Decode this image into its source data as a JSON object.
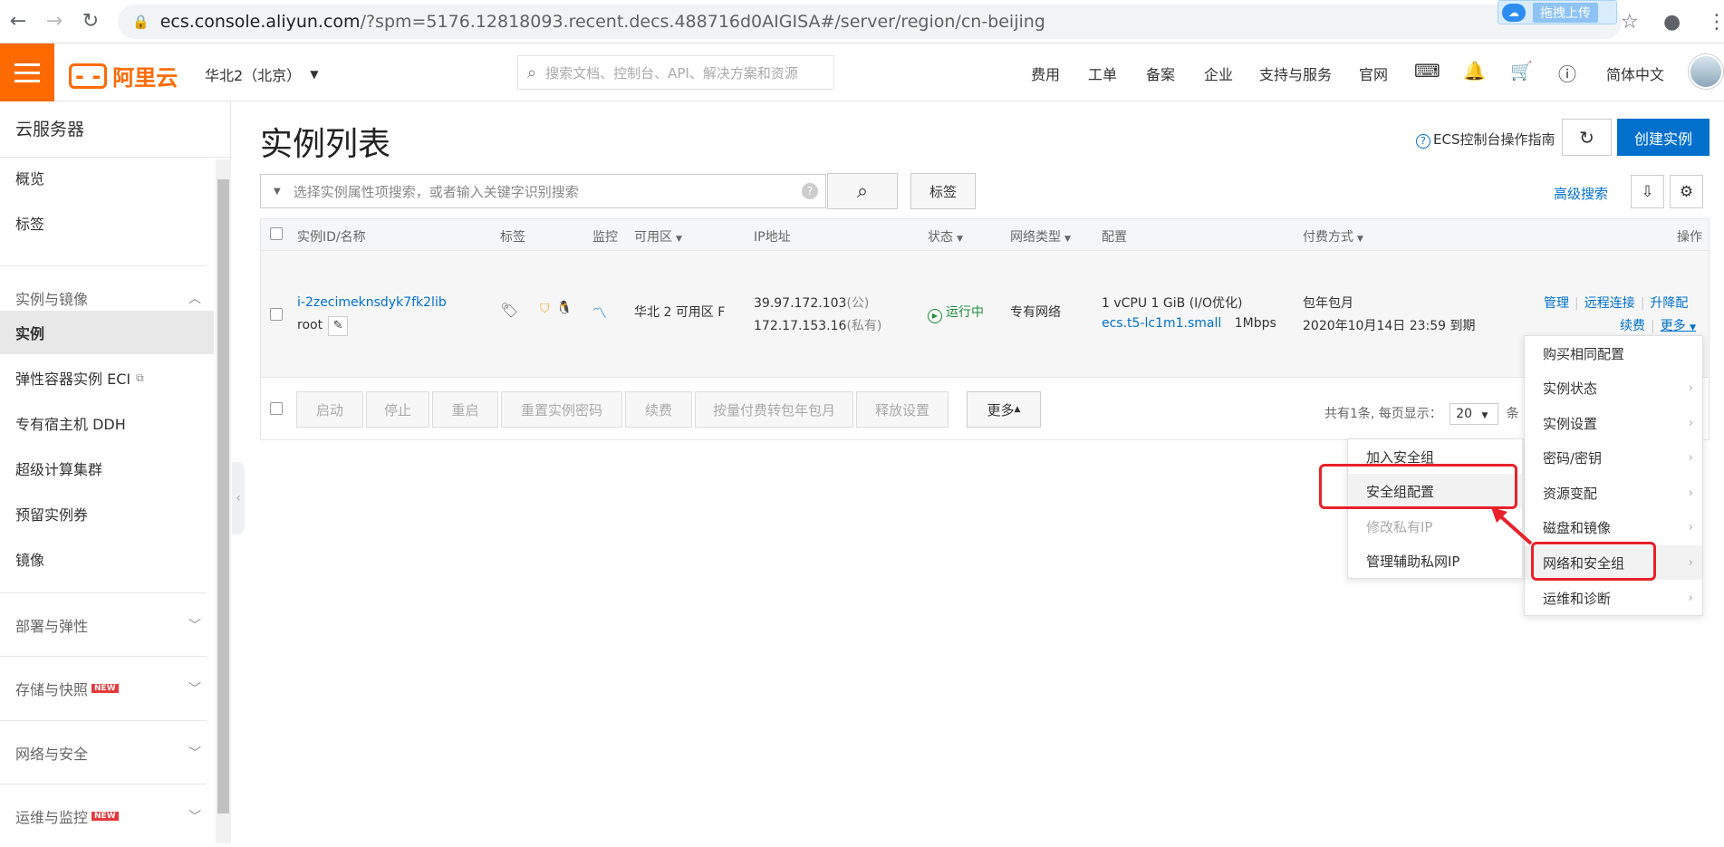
{
  "browser": {
    "url_host": "ecs.console.aliyun.com",
    "url_rest": "/?spm=5176.12818093.recent.decs.488716d0AIGISA#/server/region/cn-beijing",
    "extension_label": "拖拽上传"
  },
  "topbar": {
    "logo_text": "阿里云",
    "region": "华北2（北京）",
    "search_placeholder": "搜索文档、控制台、API、解决方案和资源",
    "nav": [
      "费用",
      "工单",
      "备案",
      "企业",
      "支持与服务",
      "官网"
    ],
    "language": "简体中文"
  },
  "sidebar": {
    "title": "云服务器",
    "items": [
      "概览",
      "标签",
      "实例与镜像",
      "实例",
      "弹性容器实例 ECI",
      "专有宿主机 DDH",
      "超级计算集群",
      "预留实例券",
      "镜像"
    ],
    "groups": [
      "部署与弹性",
      "存储与快照",
      "网络与安全",
      "运维与监控"
    ],
    "new_badge": "NEW"
  },
  "main": {
    "title": "实例列表",
    "guide": "ECS控制台操作指南",
    "create_button": "创建实例",
    "filter_placeholder": "选择实例属性项搜索，或者输入关键字识别搜索",
    "tag_button": "标签",
    "advanced_search": "高级搜索"
  },
  "table": {
    "headers": [
      "实例ID/名称",
      "标签",
      "监控",
      "可用区",
      "IP地址",
      "状态",
      "网络类型",
      "配置",
      "付费方式",
      "操作"
    ],
    "row": {
      "instance_id": "i-2zecimeknsdyk7fk2lib",
      "name": "root",
      "zone": "华北 2 可用区 F",
      "ip_public": "39.97.172.103",
      "ip_public_tag": "(公)",
      "ip_private": "172.17.153.16",
      "ip_private_tag": "(私有)",
      "status": "运行中",
      "network": "专有网络",
      "config_line1": "1 vCPU 1 GiB (I/O优化)",
      "config_type": "ecs.t5-lc1m1.small",
      "config_bw": "1Mbps",
      "pay_type": "包年包月",
      "expire": "2020年10月14日 23:59 到期",
      "actions": [
        "管理",
        "远程连接",
        "升降配",
        "续费",
        "更多"
      ]
    },
    "footer_buttons": [
      "启动",
      "停止",
      "重启",
      "重置实例密码",
      "续费",
      "按量付费转包年包月",
      "释放设置",
      "更多"
    ],
    "pager_text": "共有1条, 每页显示：",
    "page_size": "20",
    "pager_unit": "条"
  },
  "more_menu": [
    "购买相同配置",
    "实例状态",
    "实例设置",
    "密码/密钥",
    "资源变配",
    "磁盘和镜像",
    "网络和安全组",
    "运维和诊断"
  ],
  "sub_menu": [
    "加入安全组",
    "安全组配置",
    "修改私有IP",
    "管理辅助私网IP"
  ],
  "colors": {
    "brand": "#ff6a00",
    "primary": "#0070cc",
    "highlight": "#e8212a",
    "running": "#1e8e3e"
  }
}
